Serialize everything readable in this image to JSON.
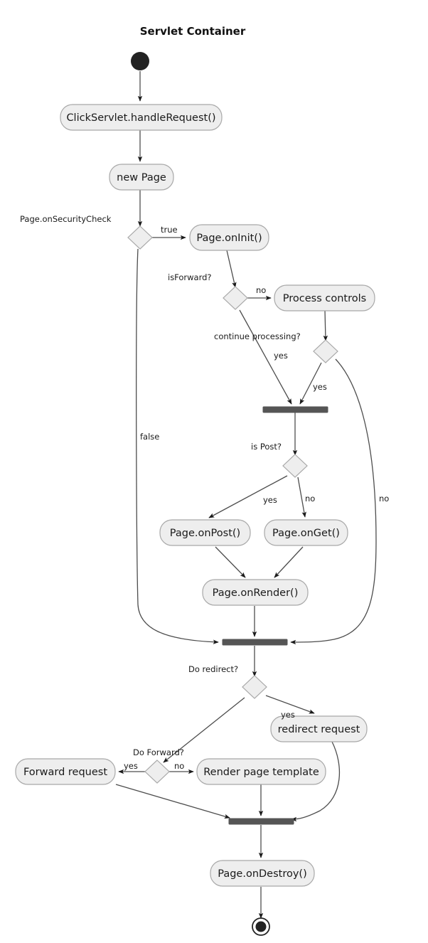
{
  "diagram": {
    "title": "Servlet Container",
    "type": "uml-activity-diagram",
    "nodes": {
      "start": {
        "label": "",
        "kind": "initial-node"
      },
      "handle_request": {
        "label": "ClickServlet.handleRequest()",
        "kind": "activity"
      },
      "new_page": {
        "label": "new Page",
        "kind": "activity"
      },
      "security_check": {
        "label": "",
        "kind": "decision"
      },
      "on_init": {
        "label": "Page.onInit()",
        "kind": "activity"
      },
      "is_forward": {
        "label": "",
        "kind": "decision"
      },
      "process_controls": {
        "label": "Process controls",
        "kind": "activity"
      },
      "continue_processing": {
        "label": "",
        "kind": "decision"
      },
      "merge_bar_1": {
        "label": "",
        "kind": "synchronization-bar"
      },
      "is_post": {
        "label": "",
        "kind": "decision"
      },
      "on_post": {
        "label": "Page.onPost()",
        "kind": "activity"
      },
      "on_get": {
        "label": "Page.onGet()",
        "kind": "activity"
      },
      "on_render": {
        "label": "Page.onRender()",
        "kind": "activity"
      },
      "merge_bar_2": {
        "label": "",
        "kind": "synchronization-bar"
      },
      "do_redirect": {
        "label": "",
        "kind": "decision"
      },
      "redirect_request": {
        "label": "redirect request",
        "kind": "activity"
      },
      "do_forward": {
        "label": "",
        "kind": "decision"
      },
      "forward_request": {
        "label": "Forward request",
        "kind": "activity"
      },
      "render_page_template": {
        "label": "Render page template",
        "kind": "activity"
      },
      "merge_bar_3": {
        "label": "",
        "kind": "synchronization-bar"
      },
      "on_destroy": {
        "label": "Page.onDestroy()",
        "kind": "activity"
      },
      "end": {
        "label": "",
        "kind": "final-node"
      }
    },
    "guard_labels": {
      "security_check": "Page.onSecurityCheck",
      "security_true": "true",
      "security_false": "false",
      "is_forward": "isForward?",
      "is_forward_no": "no",
      "continue_processing": "continue processing?",
      "continue_yes": "yes",
      "controls_yes": "yes",
      "controls_no": "no",
      "is_post": "is Post?",
      "is_post_yes": "yes",
      "is_post_no": "no",
      "do_redirect": "Do redirect?",
      "do_redirect_yes": "yes",
      "do_forward": "Do Forward?",
      "do_forward_yes": "yes",
      "do_forward_no": "no"
    },
    "colors": {
      "node_fill": "#eeeeee",
      "node_stroke": "#a8a8a8",
      "edge_stroke": "#4d4d4d",
      "bar_fill": "#555555",
      "terminal_fill": "#222222",
      "text": "#1a1a1a",
      "background": "#ffffff"
    }
  }
}
